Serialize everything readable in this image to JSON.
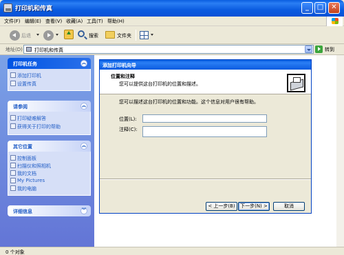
{
  "window": {
    "title": "打印机和传真",
    "min_label": "_",
    "max_label": "□",
    "close_label": "✕"
  },
  "menu": {
    "items": [
      "文件(F)",
      "编辑(E)",
      "查看(V)",
      "收藏(A)",
      "工具(T)",
      "帮助(H)"
    ]
  },
  "toolbar": {
    "back_label": "后退",
    "search_label": "搜索",
    "folders_label": "文件夹"
  },
  "address": {
    "label": "地址(D)",
    "value": "打印机和传真",
    "go_label": "转到"
  },
  "taskpane": {
    "printer_tasks": {
      "title": "打印机任务",
      "items": [
        "添加打印机",
        "设置传真"
      ]
    },
    "see_also": {
      "title": "请参阅",
      "items": [
        "打印疑难解答",
        "获得关于打印的帮助"
      ]
    },
    "other_places": {
      "title": "其它位置",
      "items": [
        "控制面板",
        "扫描仪和照相机",
        "我的文档",
        "My Pictures",
        "我的电脑"
      ]
    },
    "details": {
      "title": "详细信息"
    }
  },
  "wizard": {
    "title": "添加打印机向导",
    "header_title": "位置和注释",
    "header_subtitle": "您可以提供这台打印机的位置和描述。",
    "description": "您可以描述这台打印机的位置和功能。这个信息对用户很有帮助。",
    "location_label": "位置(L):",
    "comment_label": "注释(C):",
    "location_value": "",
    "comment_value": "",
    "back_button": "< 上一步(B)",
    "next_button": "下一步(N) >",
    "cancel_button": "取消"
  },
  "status": {
    "text": "0 个对象"
  }
}
